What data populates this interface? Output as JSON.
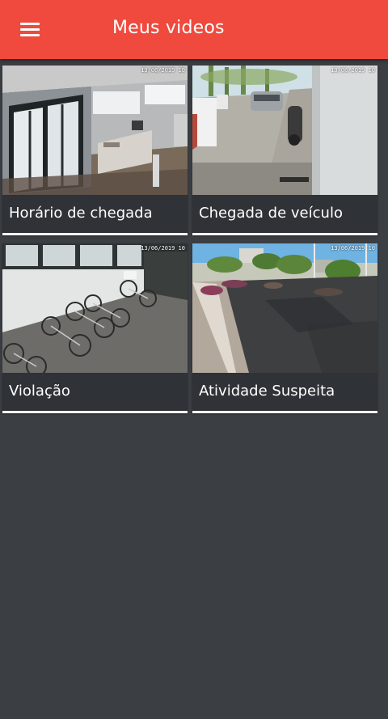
{
  "app_bar": {
    "title": "Meus videos",
    "background_color": "#ef4a3d",
    "menu_icon": "hamburger-menu-icon"
  },
  "videos": [
    {
      "title": "Horário de chegada",
      "timestamp": "13/06/2019 10",
      "scene": "office-entrance"
    },
    {
      "title": "Chegada de veículo",
      "timestamp": "13/06/2019 10",
      "scene": "parking-driveway"
    },
    {
      "title": "Violação",
      "timestamp": "13/06/2019 10",
      "scene": "bicycle-rack"
    },
    {
      "title": "Atividade Suspeita",
      "timestamp": "13/06/2019 10",
      "scene": "street-view"
    }
  ],
  "colors": {
    "background": "#3b3e42",
    "card": "#2f3236",
    "card_border": "#ffffff"
  }
}
